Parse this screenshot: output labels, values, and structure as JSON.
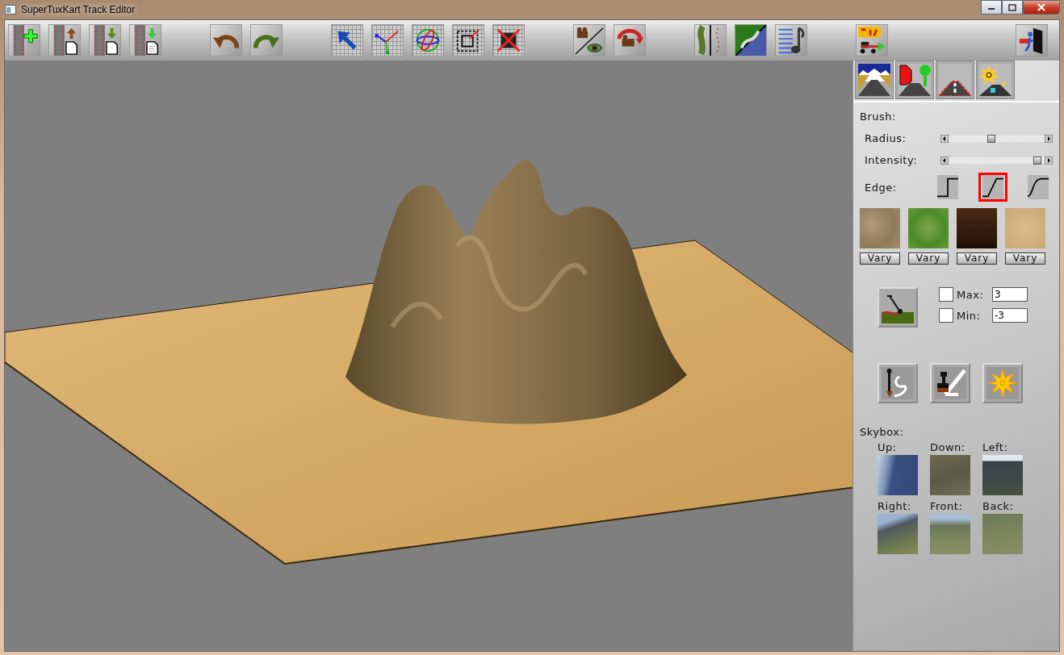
{
  "window": {
    "title": "SuperTuxKart Track Editor"
  },
  "panel": {
    "brush_label": "Brush:",
    "sliders": [
      {
        "label": "Radius:",
        "level": 0.44
      },
      {
        "label": "Intensity:",
        "level": 0.96
      }
    ],
    "edge": {
      "label": "Edge:",
      "options": [
        {
          "kind": "step",
          "selected": false
        },
        {
          "kind": "linear",
          "selected": true
        },
        {
          "kind": "smooth",
          "selected": false
        }
      ]
    },
    "textures": [
      {
        "kind": "dirt",
        "button": "Vary"
      },
      {
        "kind": "grass",
        "button": "Vary"
      },
      {
        "kind": "mud",
        "button": "Vary"
      },
      {
        "kind": "sand",
        "button": "Vary"
      }
    ],
    "limits": [
      {
        "label": "Max:",
        "checked": false,
        "value": "3"
      },
      {
        "label": "Min:",
        "checked": false,
        "value": "-3"
      }
    ],
    "skybox": {
      "label": "Skybox:",
      "faces": [
        "Up:",
        "Down:",
        "Left:",
        "Right:",
        "Front:",
        "Back:"
      ]
    }
  }
}
